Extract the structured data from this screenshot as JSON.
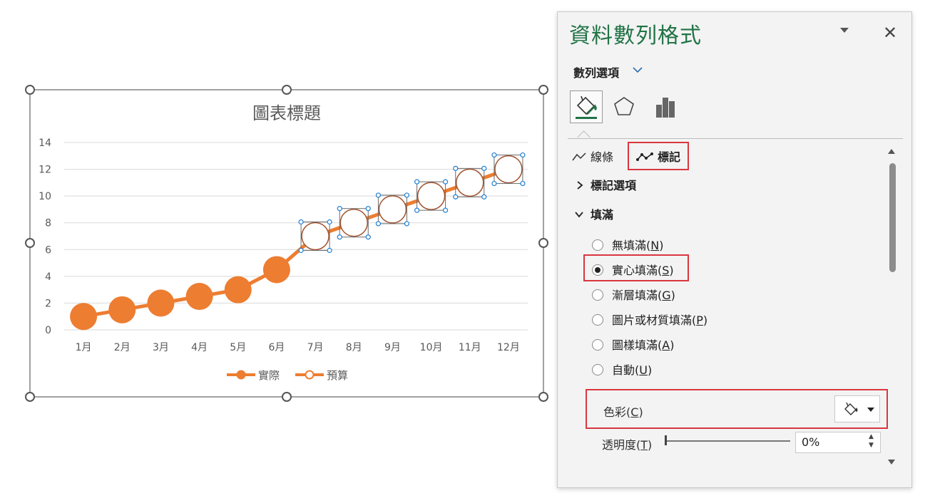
{
  "chart_data": {
    "type": "line",
    "title": "圖表標題",
    "categories": [
      "1月",
      "2月",
      "3月",
      "4月",
      "5月",
      "6月",
      "7月",
      "8月",
      "9月",
      "10月",
      "11月",
      "12月"
    ],
    "y_ticks": [
      "0",
      "2",
      "4",
      "6",
      "8",
      "10",
      "12",
      "14"
    ],
    "ylim": [
      0,
      14
    ],
    "grid": true,
    "legend_position": "bottom",
    "series": [
      {
        "name": "實際",
        "values": [
          1,
          1.5,
          2,
          2.5,
          3,
          4.5,
          null,
          null,
          null,
          null,
          null,
          null
        ],
        "color": "#ed7d31",
        "marker": "filled-circle"
      },
      {
        "name": "預算",
        "values": [
          null,
          null,
          null,
          null,
          null,
          4.5,
          7,
          8,
          9,
          10,
          11,
          12
        ],
        "color": "#ed7d31",
        "marker": "hollow-circle",
        "selected": true
      }
    ]
  },
  "pane": {
    "title": "資料數列格式",
    "close": "✕",
    "series_options": "數列選項",
    "tabs": [
      "fill-line-icon",
      "effects-icon",
      "series-options-icon"
    ],
    "sub_tabs": {
      "line": "線條",
      "marker": "標記"
    },
    "marker_options": "標記選項",
    "fill_section": "填滿",
    "fill_options": [
      {
        "text": "無填滿",
        "key": "N",
        "selected": false
      },
      {
        "text": "實心填滿",
        "key": "S",
        "selected": true
      },
      {
        "text": "漸層填滿",
        "key": "G",
        "selected": false
      },
      {
        "text": "圖片或材質填滿",
        "key": "P",
        "selected": false
      },
      {
        "text": "圖樣填滿",
        "key": "A",
        "selected": false
      },
      {
        "text": "自動",
        "key": "U",
        "selected": false
      }
    ],
    "color_label": "色彩",
    "color_key": "C",
    "transparency_label": "透明度",
    "transparency_key": "T",
    "transparency_value": "0%",
    "accent_color": "#217346",
    "highlight_color": "#d9363e"
  }
}
